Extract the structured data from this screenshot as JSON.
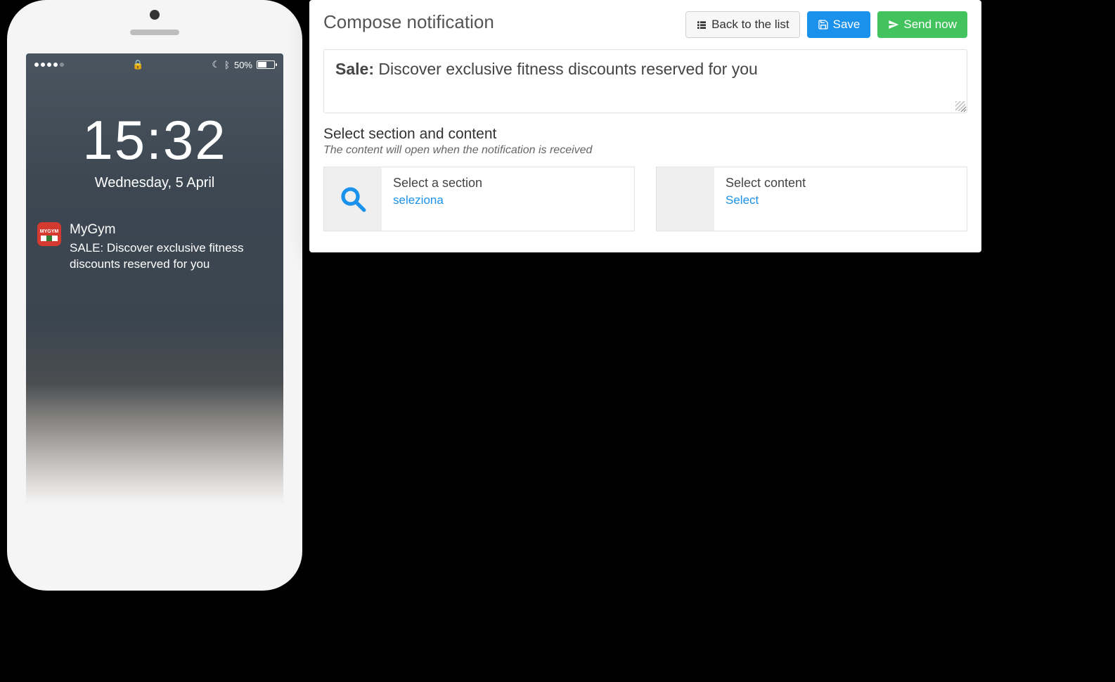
{
  "phone": {
    "status": {
      "signal_dots": 5,
      "signal_active": 4,
      "battery_pct": "50%",
      "bluetooth": true,
      "dnd": true
    },
    "clock": {
      "time": "15:32",
      "date": "Wednesday, 5 April"
    },
    "notification": {
      "app_name": "MyGym",
      "icon_text": "MYGYM",
      "text": "SALE: Discover exclusive fitness discounts reserved for you"
    }
  },
  "panel": {
    "title": "Compose notification",
    "actions": {
      "back": "Back to the list",
      "save": "Save",
      "send": "Send now"
    },
    "compose": {
      "prefix": "Sale:",
      "body": "Discover exclusive fitness discounts reserved for you"
    },
    "section": {
      "label": "Select section and content",
      "hint": "The content will open when the notification is received",
      "cards": [
        {
          "title": "Select a section",
          "link": "seleziona"
        },
        {
          "title": "Select content",
          "link": "Select"
        }
      ]
    }
  }
}
